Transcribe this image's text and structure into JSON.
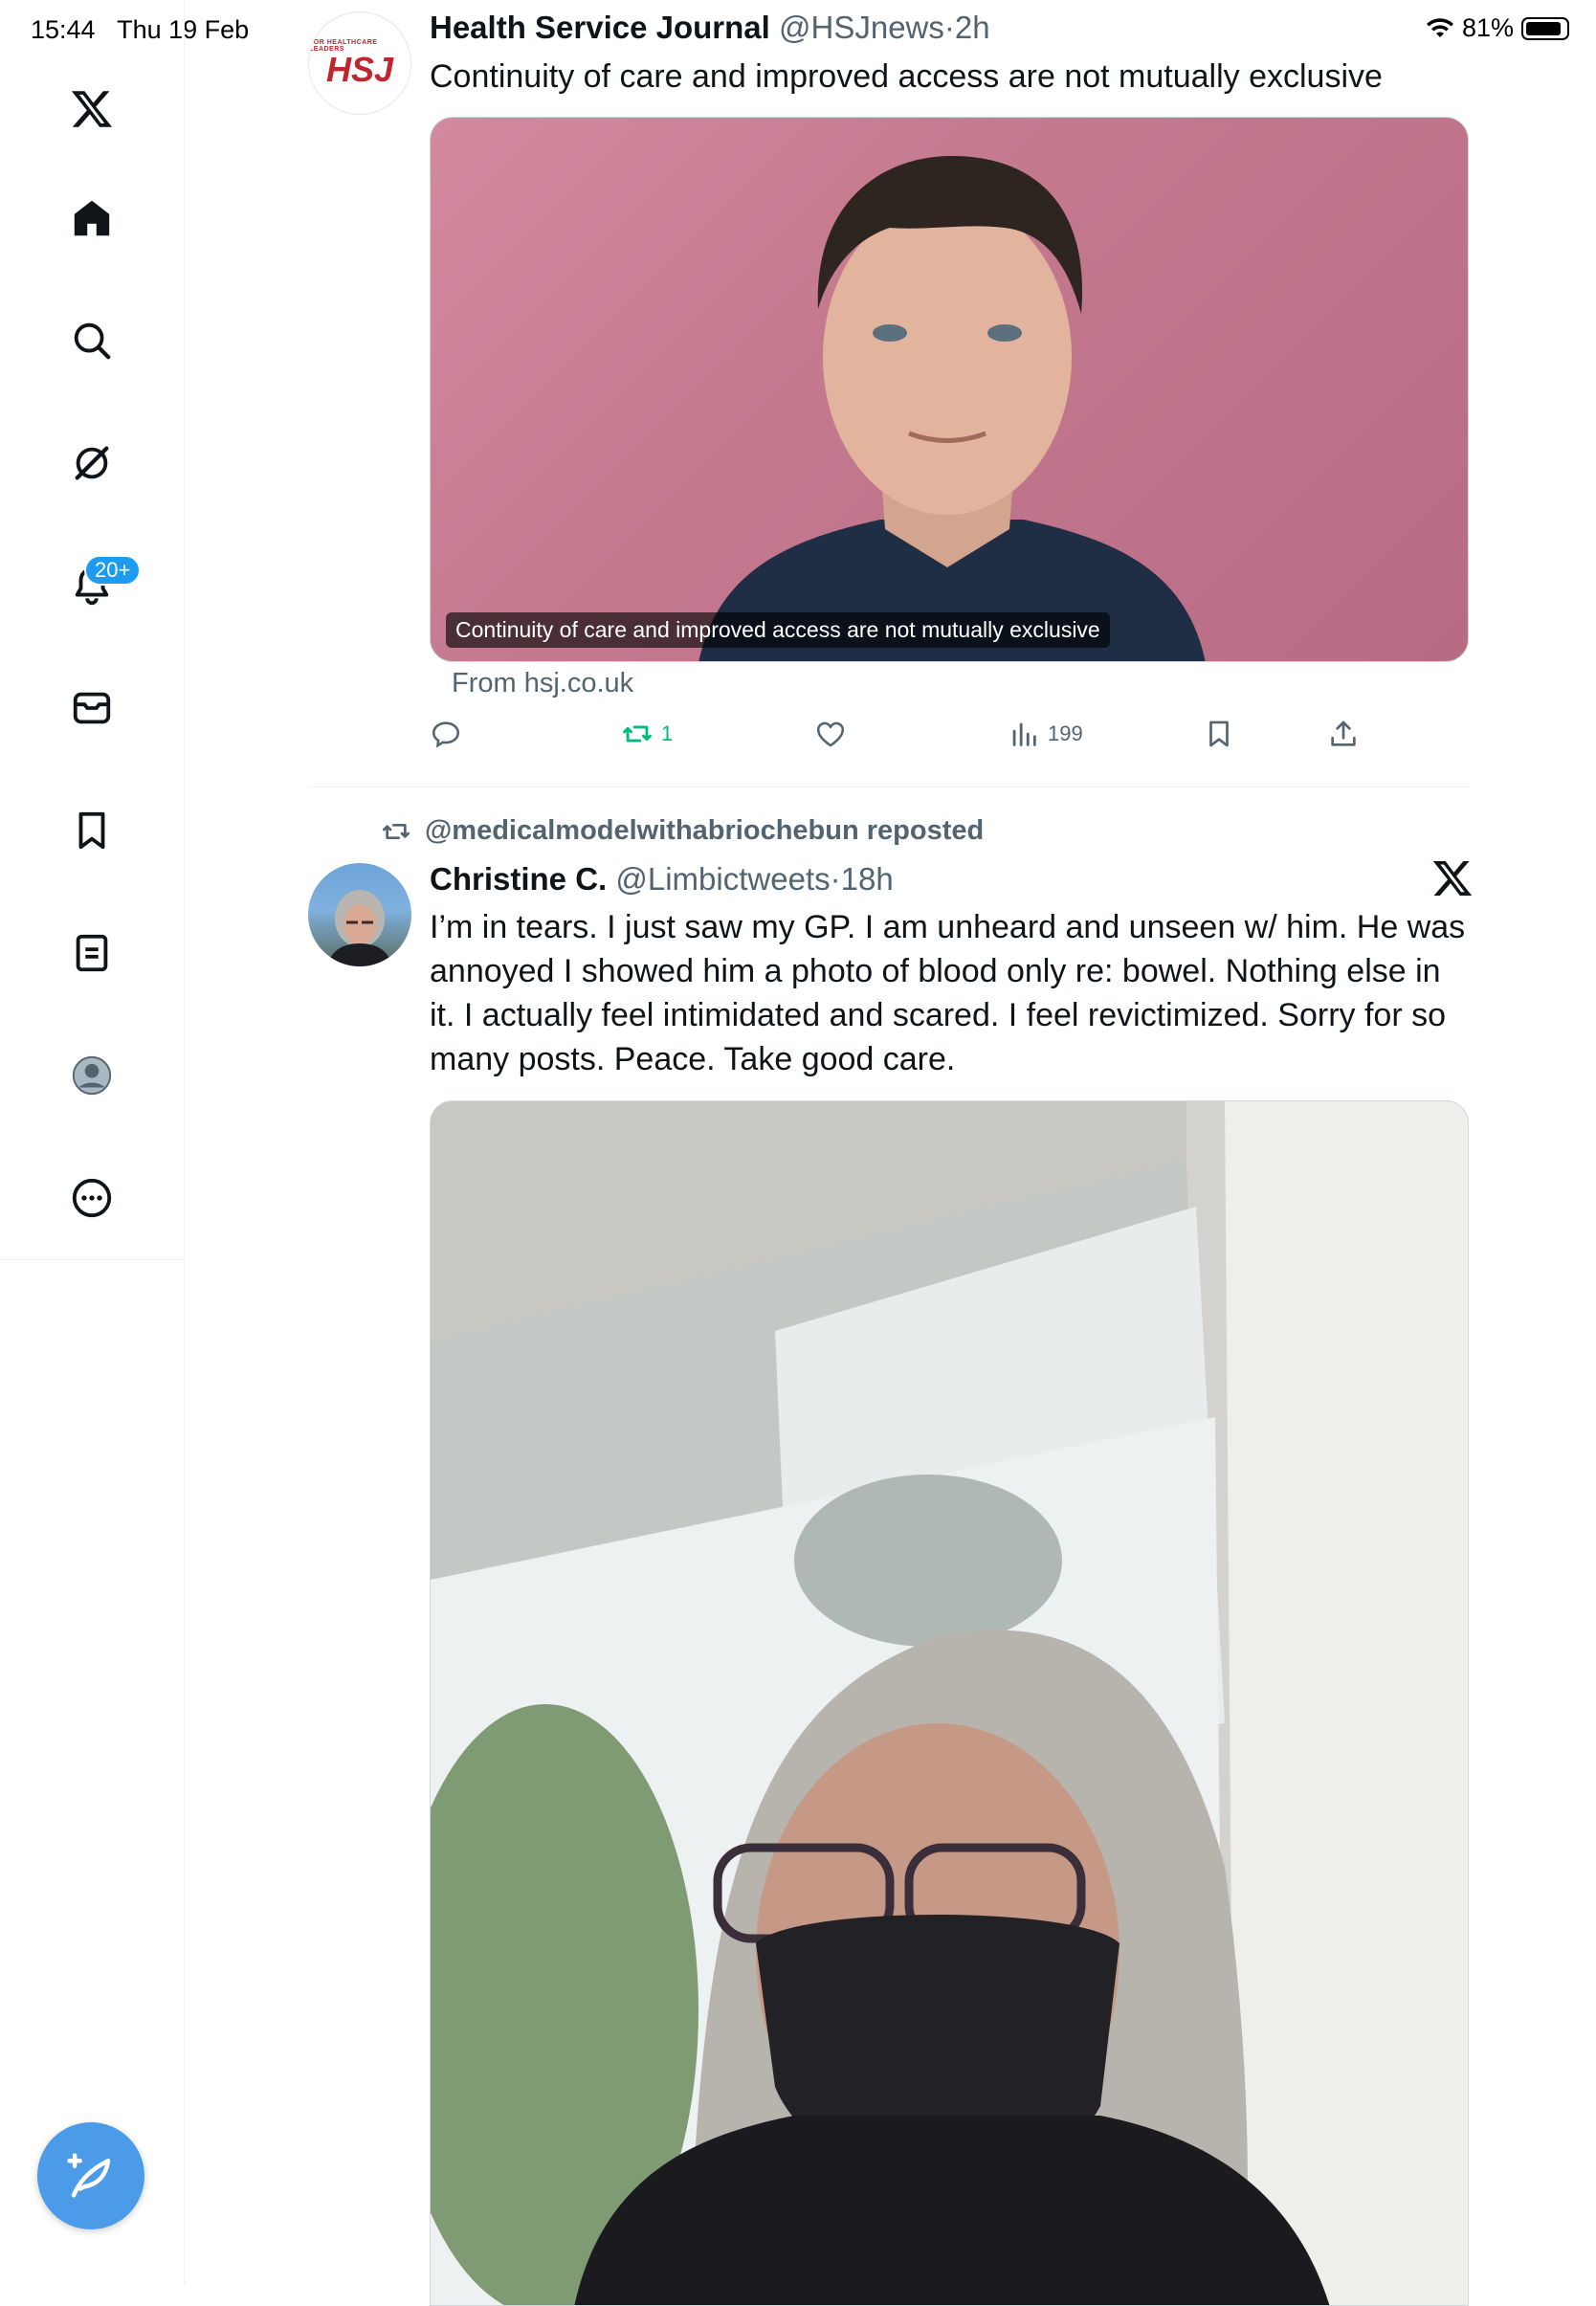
{
  "status_bar": {
    "time": "15:44",
    "date": "Thu 19 Feb",
    "battery": "81%",
    "battery_level": 0.81
  },
  "sidebar": {
    "notifications_badge": "20+",
    "items": [
      {
        "name": "x-logo-icon"
      },
      {
        "name": "home-icon"
      },
      {
        "name": "search-icon"
      },
      {
        "name": "grok-icon"
      },
      {
        "name": "bell-icon"
      },
      {
        "name": "mail-icon"
      },
      {
        "name": "bookmark-icon"
      },
      {
        "name": "lists-icon"
      },
      {
        "name": "profile-icon"
      },
      {
        "name": "more-icon"
      }
    ]
  },
  "tweet1": {
    "display_name": "Health Service Journal",
    "handle": "@HSJnews",
    "separator": "·",
    "time": "2h",
    "text": "Continuity of care and improved access are not mutually exclusive",
    "avatar_small": "FOR HEALTHCARE LEADERS",
    "avatar_big": "HSJ",
    "card_caption": "Continuity of care and improved access are not mutually exclusive",
    "card_source": "From hsj.co.uk",
    "reposts": "1",
    "views": "199"
  },
  "tweet2": {
    "repost_label": "@medicalmodelwithabriochebun reposted",
    "display_name": "Christine C.",
    "handle": "@Limbictweets",
    "separator": "·",
    "time": "18h",
    "text": "I’m in tears. I just saw my GP. I am unheard and unseen w/ him. He was annoyed I showed him a photo of blood only re: bowel. Nothing else in it. I actually feel intimidated and scared. I feel revictimized. Sorry for so many posts. Peace. Take good care."
  },
  "colors": {
    "accent": "#1d9bf0",
    "repost_green": "#00ba7c",
    "text_secondary": "#536471"
  }
}
